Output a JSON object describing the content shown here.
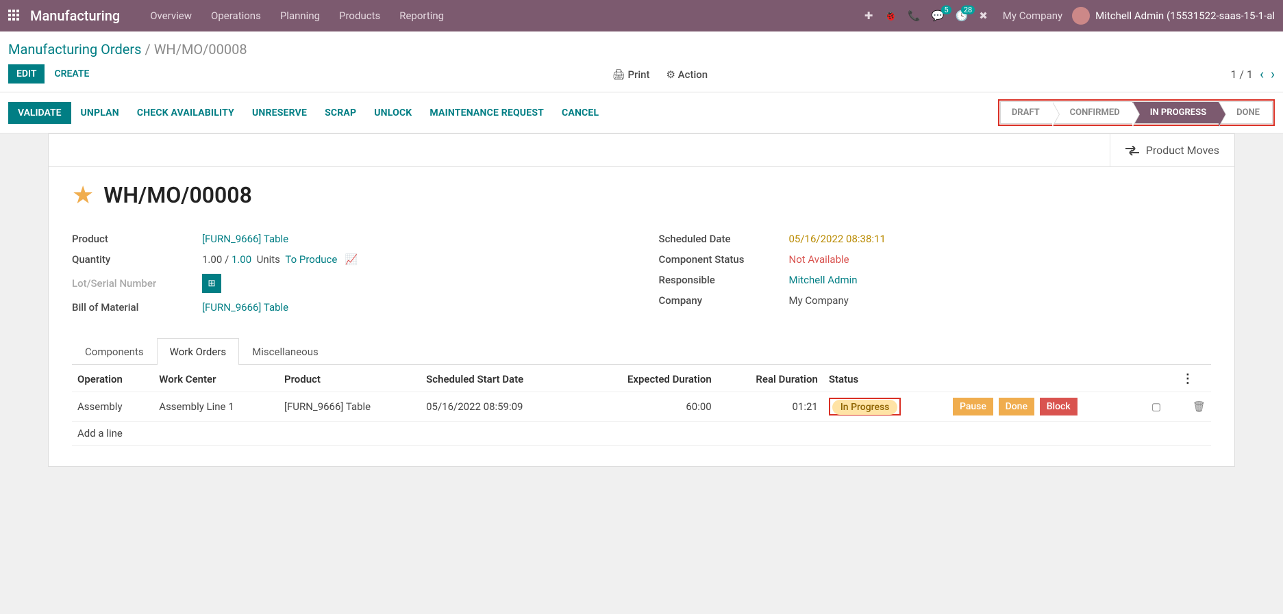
{
  "topbar": {
    "app_title": "Manufacturing",
    "nav": [
      "Overview",
      "Operations",
      "Planning",
      "Products",
      "Reporting"
    ],
    "msg_count": "5",
    "act_count": "28",
    "company": "My Company",
    "user": "Mitchell Admin (15531522-saas-15-1-al"
  },
  "breadcrumb": {
    "root": "Manufacturing Orders",
    "sep": " / ",
    "current": "WH/MO/00008"
  },
  "controlbar": {
    "edit": "EDIT",
    "create": "CREATE",
    "print": "Print",
    "action": "Action",
    "pager": "1 / 1"
  },
  "actionbar": {
    "validate": "VALIDATE",
    "actions": [
      "UNPLAN",
      "CHECK AVAILABILITY",
      "UNRESERVE",
      "SCRAP",
      "UNLOCK",
      "MAINTENANCE REQUEST",
      "CANCEL"
    ],
    "stages": [
      "DRAFT",
      "CONFIRMED",
      "IN PROGRESS",
      "DONE"
    ],
    "active_stage": 2
  },
  "sheet": {
    "product_moves": "Product Moves",
    "title": "WH/MO/00008",
    "left": {
      "product_lbl": "Product",
      "product_val": "[FURN_9666] Table",
      "qty_lbl": "Quantity",
      "qty1": "1.00",
      "qty_slash": " / ",
      "qty2": "1.00",
      "units": "Units",
      "to_produce": "To Produce",
      "lot_lbl": "Lot/Serial Number",
      "bom_lbl": "Bill of Material",
      "bom_val": "[FURN_9666] Table"
    },
    "right": {
      "sched_lbl": "Scheduled Date",
      "sched_val": "05/16/2022 08:38:11",
      "comp_lbl": "Component Status",
      "comp_val": "Not Available",
      "resp_lbl": "Responsible",
      "resp_val": "Mitchell Admin",
      "company_lbl": "Company",
      "company_val": "My Company"
    },
    "tabs": [
      "Components",
      "Work Orders",
      "Miscellaneous"
    ],
    "active_tab": 1,
    "wo": {
      "headers": {
        "op": "Operation",
        "wc": "Work Center",
        "prod": "Product",
        "ssd": "Scheduled Start Date",
        "exp": "Expected Duration",
        "real": "Real Duration",
        "status": "Status"
      },
      "row": {
        "op": "Assembly",
        "wc": "Assembly Line 1",
        "prod": "[FURN_9666] Table",
        "ssd": "05/16/2022 08:59:09",
        "exp": "60:00",
        "real": "01:21",
        "status": "In Progress",
        "pause": "Pause",
        "done": "Done",
        "block": "Block"
      },
      "add": "Add a line"
    }
  }
}
